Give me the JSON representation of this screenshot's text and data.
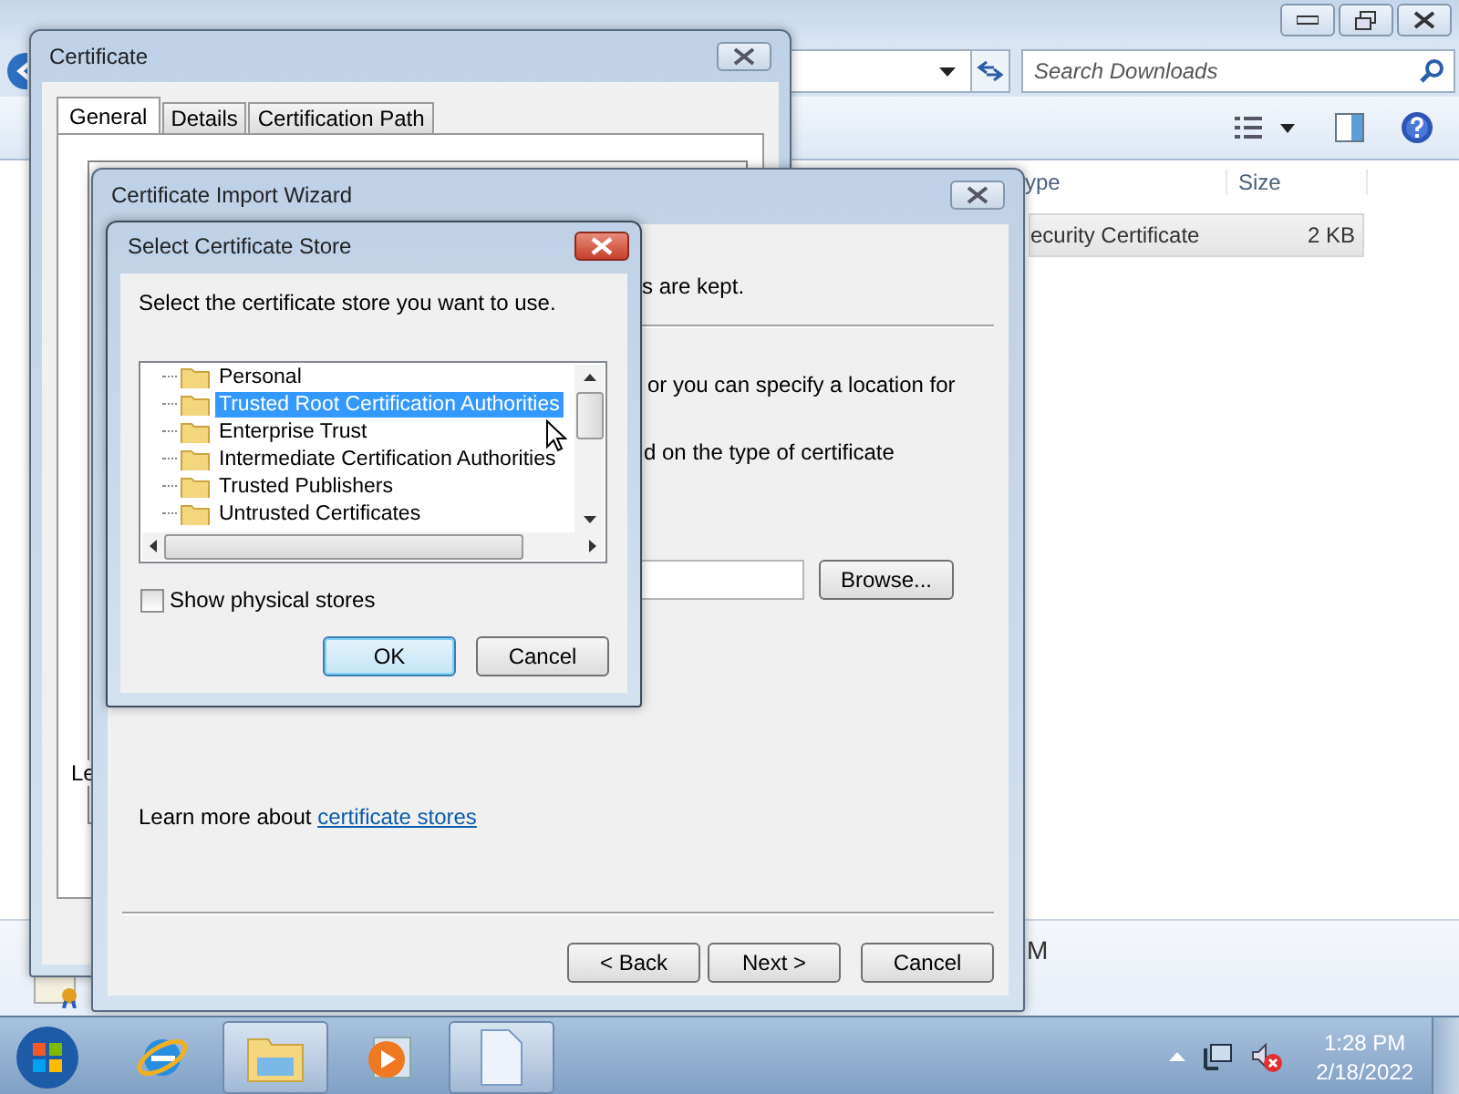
{
  "explorer": {
    "search": {
      "placeholder": "Search Downloads"
    },
    "columns": [
      "ype",
      "Size"
    ],
    "rows": [
      {
        "cells": [
          "ecurity Certificate",
          "2 KB"
        ],
        "selected": true
      }
    ],
    "details_text": "M"
  },
  "certificate_window": {
    "title": "Certificate",
    "tabs": [
      {
        "label": "General",
        "selected": true
      },
      {
        "label": "Details",
        "selected": false
      },
      {
        "label": "Certification Path",
        "selected": false
      }
    ],
    "body_text": "Le"
  },
  "wizard": {
    "title": "Certificate Import Wizard",
    "texts": [
      "s are kept.",
      "or you can specify a location for",
      "d on the type of certificate"
    ],
    "browse_button": "Browse...",
    "learn_more": {
      "text": "Learn more about",
      "link": "certificate stores"
    },
    "buttons": [
      "< Back",
      "Next >",
      "Cancel"
    ]
  },
  "store_dialog": {
    "title": "Select Certificate Store",
    "prompt": "Select the certificate store you want to use.",
    "stores": [
      {
        "label": "Personal",
        "selected": false
      },
      {
        "label": "Trusted Root Certification Authorities",
        "selected": true
      },
      {
        "label": "Enterprise Trust",
        "selected": false
      },
      {
        "label": "Intermediate Certification Authorities",
        "selected": false
      },
      {
        "label": "Trusted Publishers",
        "selected": false
      },
      {
        "label": "Untrusted Certificates",
        "selected": false
      }
    ],
    "show_physical": {
      "label": "Show physical stores",
      "checked": false
    },
    "buttons": [
      {
        "label": "OK",
        "default": true
      },
      {
        "label": "Cancel",
        "default": false
      }
    ]
  },
  "taskbar": {
    "apps": [
      {
        "kind": "browser",
        "active": false
      },
      {
        "kind": "folder",
        "active": true
      },
      {
        "kind": "media",
        "active": false
      },
      {
        "kind": "document",
        "active": true
      }
    ],
    "clock": {
      "time": "1:28 PM",
      "date": "2/18/2022"
    }
  }
}
